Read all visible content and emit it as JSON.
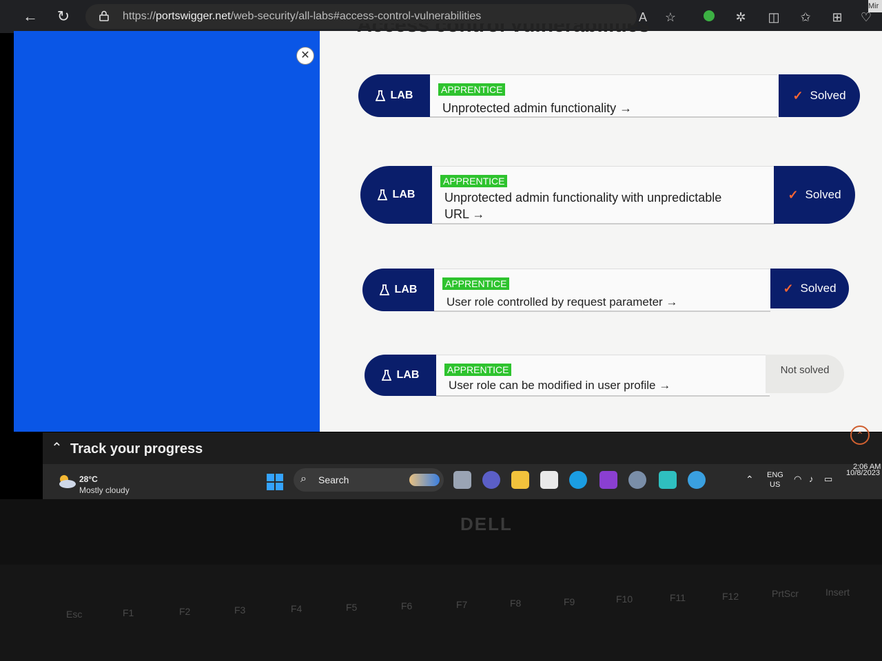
{
  "browser": {
    "url_prefix": "https://",
    "url_domain": "portswigger.net",
    "url_path": "/web-security/all-labs#access-control-vulnerabilities",
    "corner_badge": "Mir",
    "toolbar_icons": [
      "back-icon",
      "refresh-icon",
      "read-aloud-icon",
      "favorite-star-icon",
      "extension-green-icon",
      "extensions-icon",
      "split-screen-icon",
      "favorites-icon",
      "collections-icon",
      "browser-essentials-icon"
    ]
  },
  "page": {
    "heading": "Access control vulnerabilities",
    "labs": [
      {
        "badge": "LAB",
        "level": "APPRENTICE",
        "title": "Unprotected admin functionality →",
        "status": "Solved",
        "solved": true
      },
      {
        "badge": "LAB",
        "level": "APPRENTICE",
        "title_line1": "Unprotected admin functionality with unpredictable",
        "title_line2": "URL →",
        "status": "Solved",
        "solved": true
      },
      {
        "badge": "LAB",
        "level": "APPRENTICE",
        "title": "User role controlled by request parameter →",
        "status": "Solved",
        "solved": true
      },
      {
        "badge": "LAB",
        "level": "APPRENTICE",
        "title": "User role can be modified in user profile →",
        "status": "Not solved",
        "solved": false
      }
    ],
    "track_progress": "Track your progress",
    "colors": {
      "panel_blue": "#0a56e6",
      "badge_navy": "#0a1e6b",
      "apprentice_green": "#2ec32e",
      "check_orange": "#ff6633"
    }
  },
  "taskbar": {
    "temperature": "28°C",
    "weather": "Mostly cloudy",
    "search_label": "Search",
    "lang_line1": "ENG",
    "lang_line2": "US",
    "time": "2:06 AM",
    "date": "10/8/2023"
  },
  "laptop": {
    "brand": "DELL",
    "fkeys": [
      "Esc",
      "F1",
      "F2",
      "F3",
      "F4",
      "F5",
      "F6",
      "F7",
      "F8",
      "F9",
      "F10",
      "F11",
      "F12",
      "PrtScr",
      "Insert"
    ]
  }
}
